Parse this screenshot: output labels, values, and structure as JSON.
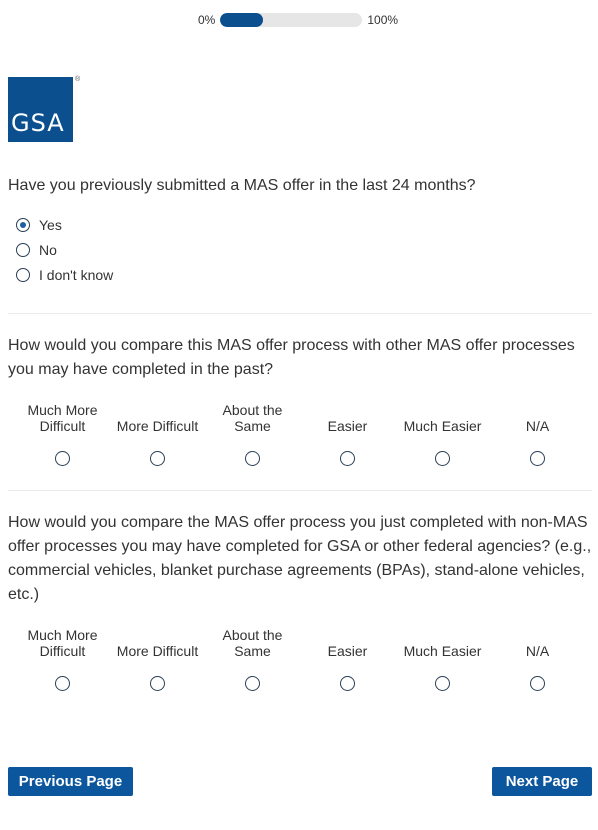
{
  "progress": {
    "start_label": "0%",
    "end_label": "100%",
    "fraction": 0.3
  },
  "logo": {
    "text": "GSA",
    "reg_mark": "®"
  },
  "question1": {
    "text": "Have you previously submitted a MAS offer in the last 24 months?",
    "options": [
      "Yes",
      "No",
      "I don't know"
    ],
    "selected": "Yes"
  },
  "question2": {
    "text": "How would you compare this MAS offer process with other MAS offer processes you may have completed in the past?",
    "scale": [
      "Much More Difficult",
      "More Difficult",
      "About the Same",
      "Easier",
      "Much Easier",
      "N/A"
    ]
  },
  "question3": {
    "text": "How would you compare the MAS offer process you just completed with non-MAS offer processes you may have completed for GSA or other federal agencies? (e.g., commercial vehicles, blanket purchase agreements (BPAs), stand-alone vehicles, etc.)",
    "scale": [
      "Much More Difficult",
      "More Difficult",
      "About the Same",
      "Easier",
      "Much Easier",
      "N/A"
    ]
  },
  "buttons": {
    "previous": "Previous Page",
    "next": "Next Page"
  },
  "colors": {
    "accent": "#0b569c",
    "progress": "#0b4f8e"
  }
}
